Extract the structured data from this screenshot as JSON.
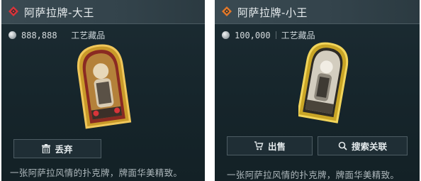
{
  "panels": [
    {
      "title": "阿萨拉牌-大王",
      "rarity_color": "#d8343a",
      "value": "888,888",
      "category": "工艺藏品",
      "actions": [
        {
          "label": "丢弃",
          "icon": "trash-icon"
        }
      ],
      "description": "一张阿萨拉风情的扑克牌，牌面华美精致。"
    },
    {
      "title": "阿萨拉牌-小王",
      "rarity_color": "#e2782a",
      "value": "100,000",
      "category": "工艺藏品",
      "actions": [
        {
          "label": "出售",
          "icon": "sell-icon"
        },
        {
          "label": "搜索关联",
          "icon": "search-icon"
        }
      ],
      "description": "一张阿萨拉风情的扑克牌，牌面华美精致。"
    }
  ]
}
